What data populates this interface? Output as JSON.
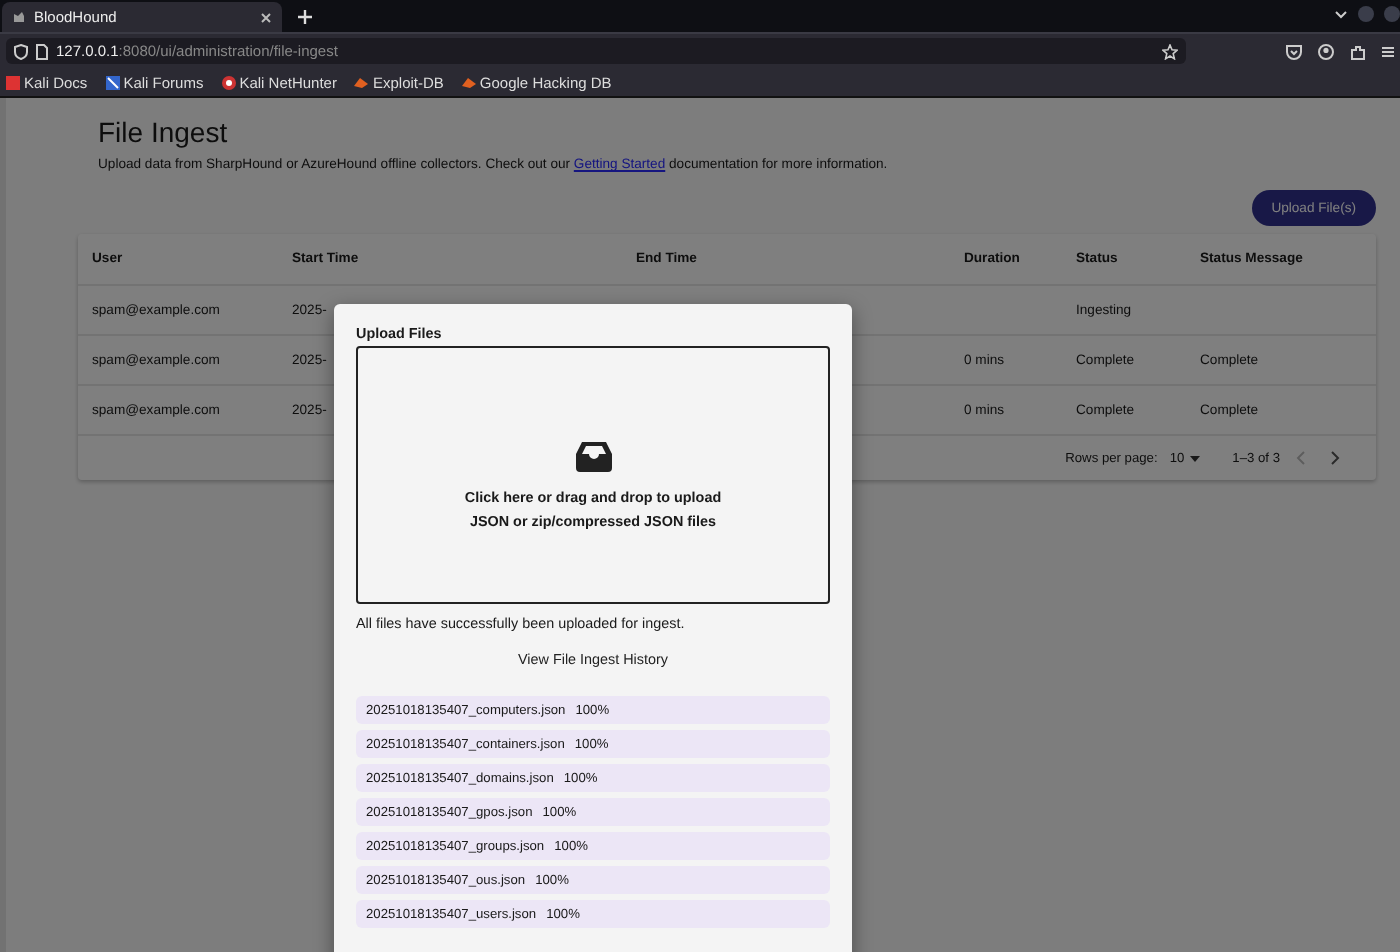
{
  "browser": {
    "tabs": [
      {
        "title": "BloodHound",
        "selected": true
      }
    ],
    "url": {
      "host": "127.0.0.1",
      "path": ":8080/ui/administration/file-ingest"
    },
    "bookmarks": [
      {
        "label": "Kali Docs"
      },
      {
        "label": "Kali Forums"
      },
      {
        "label": "Kali NetHunter"
      },
      {
        "label": "Exploit-DB"
      },
      {
        "label": "Google Hacking DB"
      }
    ]
  },
  "page": {
    "title": "File Ingest",
    "description": {
      "before": "Upload data from SharpHound or AzureHound offline collectors. Check out our ",
      "link": "Getting Started",
      "after": " documentation for more information."
    },
    "upload_button": "Upload File(s)",
    "table": {
      "columns": [
        "User",
        "Start Time",
        "End Time",
        "Duration",
        "Status",
        "Status Message"
      ],
      "rows": [
        {
          "cells": [
            "spam@example.com",
            "2025-",
            "",
            "",
            "Ingesting",
            ""
          ]
        },
        {
          "cells": [
            "spam@example.com",
            "2025-",
            "",
            "0 mins",
            "Complete",
            "Complete"
          ]
        },
        {
          "cells": [
            "spam@example.com",
            "2025-",
            "",
            "0 mins",
            "Complete",
            "Complete"
          ]
        }
      ],
      "pagination": {
        "rows_per_page_label": "Rows per page:",
        "rows_per_page": "10",
        "range": "1–3 of 3",
        "prev_disabled": true,
        "next_disabled": false
      }
    }
  },
  "dialog": {
    "title": "Upload Files",
    "dropzone_lines": [
      "Click here or drag and drop to upload",
      "JSON or zip/compressed JSON files"
    ],
    "message": "All files have successfully been uploaded for ingest.",
    "history_button": "View File Ingest History",
    "files": [
      {
        "name": "20251018135407_computers.json",
        "progress": "100%"
      },
      {
        "name": "20251018135407_containers.json",
        "progress": "100%"
      },
      {
        "name": "20251018135407_domains.json",
        "progress": "100%"
      },
      {
        "name": "20251018135407_gpos.json",
        "progress": "100%"
      },
      {
        "name": "20251018135407_groups.json",
        "progress": "100%"
      },
      {
        "name": "20251018135407_ous.json",
        "progress": "100%"
      },
      {
        "name": "20251018135407_users.json",
        "progress": "100%"
      }
    ]
  }
}
